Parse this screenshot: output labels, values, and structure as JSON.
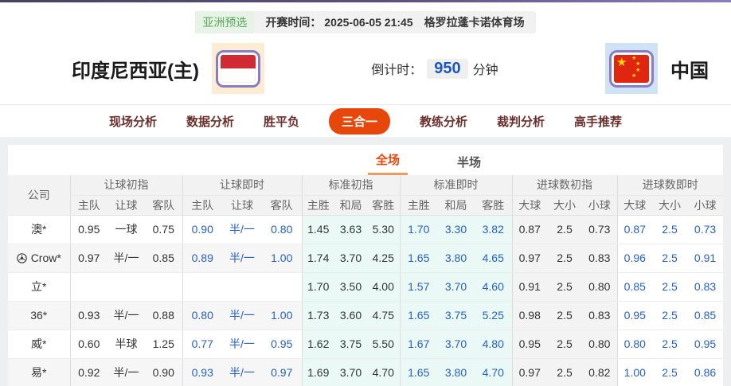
{
  "header": {
    "league_badge": "亚洲预选",
    "kickoff": "开赛时间： 2025-06-05 21:45",
    "venue": "格罗拉蓬卡诺体育场",
    "home_team": "印度尼西亚(主)",
    "away_team": "中国",
    "home_flag": "indonesia-flag",
    "away_flag": "china-flag",
    "countdown_label": "倒计时：",
    "countdown_value": "950",
    "countdown_unit": "分钟"
  },
  "nav": {
    "tabs": [
      {
        "label": "现场分析",
        "active": false
      },
      {
        "label": "数据分析",
        "active": false
      },
      {
        "label": "胜平负",
        "active": false
      },
      {
        "label": "三合一",
        "active": true
      },
      {
        "label": "教练分析",
        "active": false
      },
      {
        "label": "裁判分析",
        "active": false
      },
      {
        "label": "高手推荐",
        "active": false
      }
    ]
  },
  "subtabs": [
    {
      "label": "全场",
      "active": true
    },
    {
      "label": "半场",
      "active": false
    }
  ],
  "table": {
    "company_header": "公司",
    "groups": [
      {
        "label": "让球初指",
        "cols": [
          "主队",
          "让球",
          "客队"
        ]
      },
      {
        "label": "让球即时",
        "cols": [
          "主队",
          "让球",
          "客队"
        ]
      },
      {
        "label": "标准初指",
        "cols": [
          "主胜",
          "和局",
          "客胜"
        ]
      },
      {
        "label": "标准即时",
        "cols": [
          "主胜",
          "和局",
          "客胜"
        ]
      },
      {
        "label": "进球数初指",
        "cols": [
          "大球",
          "大小",
          "小球"
        ]
      },
      {
        "label": "进球数即时",
        "cols": [
          "大球",
          "大小",
          "小球"
        ]
      }
    ],
    "rows": [
      {
        "company": "澳*",
        "has_icon": false,
        "cells": [
          "0.95",
          "一球",
          "0.75",
          "0.90",
          "半/一",
          "0.80",
          "1.45",
          "3.63",
          "5.30",
          "1.70",
          "3.30",
          "3.82",
          "0.87",
          "2.5",
          "0.73",
          "0.87",
          "2.5",
          "0.73"
        ]
      },
      {
        "company": "Crow*",
        "has_icon": true,
        "cells": [
          "0.97",
          "半/一",
          "0.85",
          "0.89",
          "半/一",
          "1.00",
          "1.74",
          "3.70",
          "4.25",
          "1.65",
          "3.80",
          "4.65",
          "0.97",
          "2.5",
          "0.83",
          "0.96",
          "2.5",
          "0.91"
        ]
      },
      {
        "company": "立*",
        "has_icon": false,
        "cells": [
          "",
          "",
          "",
          "",
          "",
          "",
          "1.70",
          "3.50",
          "4.00",
          "1.57",
          "3.70",
          "4.60",
          "0.91",
          "2.5",
          "0.80",
          "0.85",
          "2.5",
          "0.83"
        ]
      },
      {
        "company": "36*",
        "has_icon": false,
        "cells": [
          "0.93",
          "半/一",
          "0.88",
          "0.80",
          "半/一",
          "1.00",
          "1.73",
          "3.60",
          "4.75",
          "1.65",
          "3.75",
          "5.25",
          "0.98",
          "2.5",
          "0.83",
          "0.95",
          "2.5",
          "0.85"
        ]
      },
      {
        "company": "威*",
        "has_icon": false,
        "cells": [
          "0.60",
          "半球",
          "1.25",
          "0.77",
          "半/一",
          "0.95",
          "1.62",
          "3.75",
          "5.50",
          "1.67",
          "3.70",
          "4.80",
          "0.95",
          "2.5",
          "0.80",
          "0.80",
          "2.5",
          "0.95"
        ]
      },
      {
        "company": "易*",
        "has_icon": false,
        "cells": [
          "0.92",
          "半/一",
          "0.90",
          "0.93",
          "半/一",
          "0.97",
          "1.69",
          "3.70",
          "4.70",
          "1.65",
          "3.80",
          "4.70",
          "0.97",
          "2.5",
          "0.82",
          "1.00",
          "2.5",
          "0.86"
        ]
      }
    ]
  },
  "colors": {
    "accent_orange": "#E8470C",
    "live_blue": "#2660C4",
    "badge_green": "#57A757",
    "flag_border_purple": "#8A7CC0",
    "standard_cyan_bg": "#EAF9F6",
    "topbar_purple_left": "#46415F",
    "topbar_purple_right": "#8B7CC2"
  }
}
